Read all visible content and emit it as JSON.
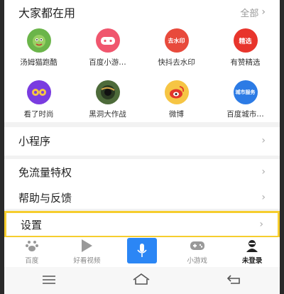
{
  "section": {
    "title": "大家都在用",
    "all_label": "全部"
  },
  "apps": [
    {
      "label": "汤姆猫跑酷",
      "icon": "tom-cat-icon",
      "color": "#6bb54a",
      "glyph": ""
    },
    {
      "label": "百度小游…",
      "icon": "game-controller-icon",
      "color": "#f0566e",
      "glyph": ""
    },
    {
      "label": "快抖去水印",
      "icon": "watermark-icon",
      "color": "#e84a3c",
      "glyph": "去水印"
    },
    {
      "label": "有赞精选",
      "icon": "youzan-icon",
      "color": "#e8352c",
      "glyph": "精选"
    },
    {
      "label": "看了时尚",
      "icon": "fashion-icon",
      "color": "#7a3ce0",
      "glyph": ""
    },
    {
      "label": "黑洞大作战",
      "icon": "black-hole-icon",
      "color": "#4d6b3a",
      "glyph": ""
    },
    {
      "label": "微博",
      "icon": "weibo-icon",
      "color": "#f6c544",
      "glyph": ""
    },
    {
      "label": "百度城市…",
      "icon": "city-service-icon",
      "color": "#2c7be5",
      "glyph": "城市服务"
    }
  ],
  "rows": {
    "mini_program": "小程序",
    "free_traffic": "免流量特权",
    "help_feedback": "帮助与反馈",
    "settings": "设置"
  },
  "tabs": [
    {
      "label": "百度",
      "icon": "baidu-paw-icon",
      "active": false
    },
    {
      "label": "好看视频",
      "icon": "play-icon",
      "active": false
    },
    {
      "label": "",
      "icon": "microphone-icon",
      "active": false
    },
    {
      "label": "小游戏",
      "icon": "gamepad-icon",
      "active": false
    },
    {
      "label": "未登录",
      "icon": "user-avatar-icon",
      "active": true
    }
  ],
  "colors": {
    "accent": "#2b86f5",
    "highlight": "#f6cd2e"
  }
}
